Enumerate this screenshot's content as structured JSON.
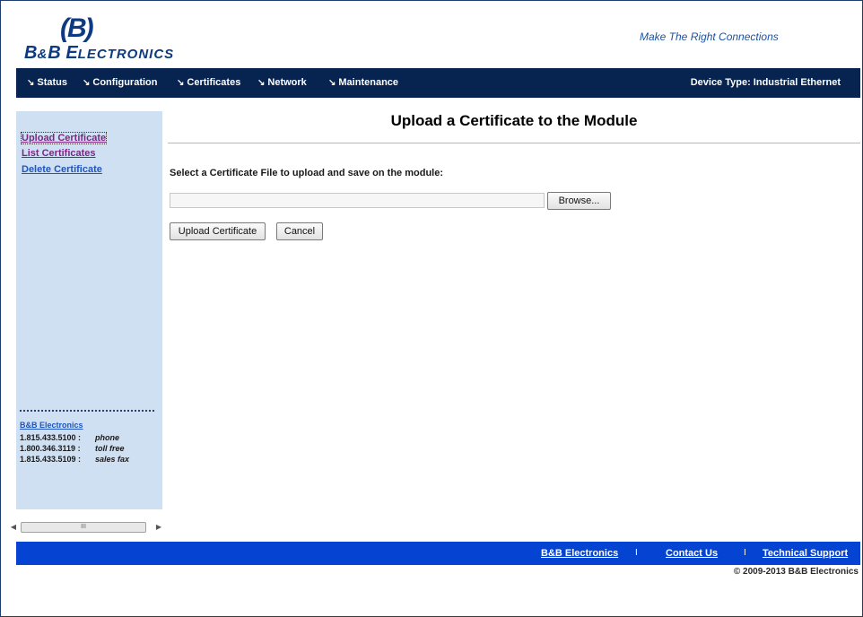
{
  "brand": {
    "mark": "(B)",
    "name_big1": "B",
    "name_amp": "&",
    "name_big2": "B",
    "name_e": "E",
    "name_rest": "LECTRONICS",
    "tagline": "Make The Right Connections"
  },
  "nav": {
    "items": [
      {
        "label": "Status"
      },
      {
        "label": "Configuration"
      },
      {
        "label": "Certificates"
      },
      {
        "label": "Network"
      },
      {
        "label": "Maintenance"
      }
    ],
    "device_type": "Device Type: Industrial Ethernet"
  },
  "sidebar": {
    "links": [
      {
        "label": "Upload Certificate"
      },
      {
        "label": "List Certificates"
      },
      {
        "label": "Delete Certificate"
      }
    ],
    "contact": {
      "title": "B&B Electronics",
      "rows": [
        {
          "number": "1.815.433.5100 :",
          "kind": "phone"
        },
        {
          "number": "1.800.346.3119 :",
          "kind": "toll free"
        },
        {
          "number": "1.815.433.5109 :",
          "kind": "sales fax"
        }
      ]
    }
  },
  "main": {
    "title": "Upload a Certificate to the Module",
    "prompt": "Select a Certificate File to upload and save on the module:",
    "file_value": "",
    "browse_label": "Browse...",
    "upload_label": "Upload Certificate",
    "cancel_label": "Cancel"
  },
  "scrollbar": {
    "grip": "III"
  },
  "footer": {
    "links": [
      {
        "label": "B&B Electronics"
      },
      {
        "label": "Contact Us"
      },
      {
        "label": "Technical Support"
      }
    ],
    "separator": "I",
    "copyright": "© 2009-2013 B&B Electronics"
  },
  "colors": {
    "nav_bg": "#06244f",
    "sidebar_bg": "#cfe0f3",
    "footer_bg": "#0543d2",
    "brand": "#0d3a80"
  }
}
